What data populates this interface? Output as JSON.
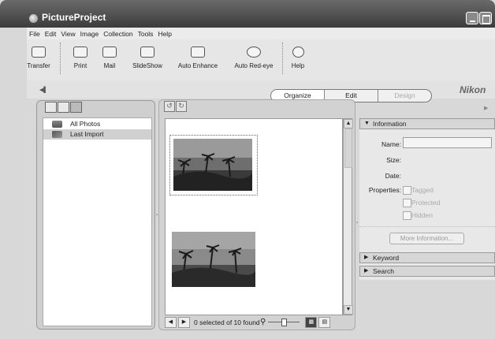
{
  "window": {
    "title": "PictureProject"
  },
  "menu": [
    "File",
    "Edit",
    "View",
    "Image",
    "Collection",
    "Tools",
    "Help"
  ],
  "toolbar": [
    {
      "label": "Transfer",
      "icon": "transfer-icon"
    },
    {
      "label": "Print",
      "icon": "printer-icon"
    },
    {
      "label": "Mail",
      "icon": "mail-icon"
    },
    {
      "label": "SlideShow",
      "icon": "slideshow-icon"
    },
    {
      "label": "Auto Enhance",
      "icon": "enhance-icon"
    },
    {
      "label": "Auto Red-eye",
      "icon": "eye-icon"
    },
    {
      "label": "Help",
      "icon": "help-icon"
    }
  ],
  "tabs": [
    {
      "label": "Organize",
      "active": true
    },
    {
      "label": "Edit",
      "active": false
    },
    {
      "label": "Design",
      "active": false
    }
  ],
  "brand": "Nikon",
  "collections": [
    {
      "label": "All Photos",
      "selected": false,
      "icon": "all-photos-icon"
    },
    {
      "label": "Last Import",
      "selected": true,
      "icon": "last-import-icon"
    }
  ],
  "status": {
    "text": "0 selected of 10 found"
  },
  "info_panel": {
    "title": "Information",
    "name_label": "Name:",
    "size_label": "Size:",
    "date_label": "Date:",
    "properties_label": "Properties:",
    "properties": [
      "Tagged",
      "Protected",
      "Hidden"
    ],
    "more_button": "More Information..."
  },
  "sections": [
    "Keyword",
    "Search"
  ]
}
